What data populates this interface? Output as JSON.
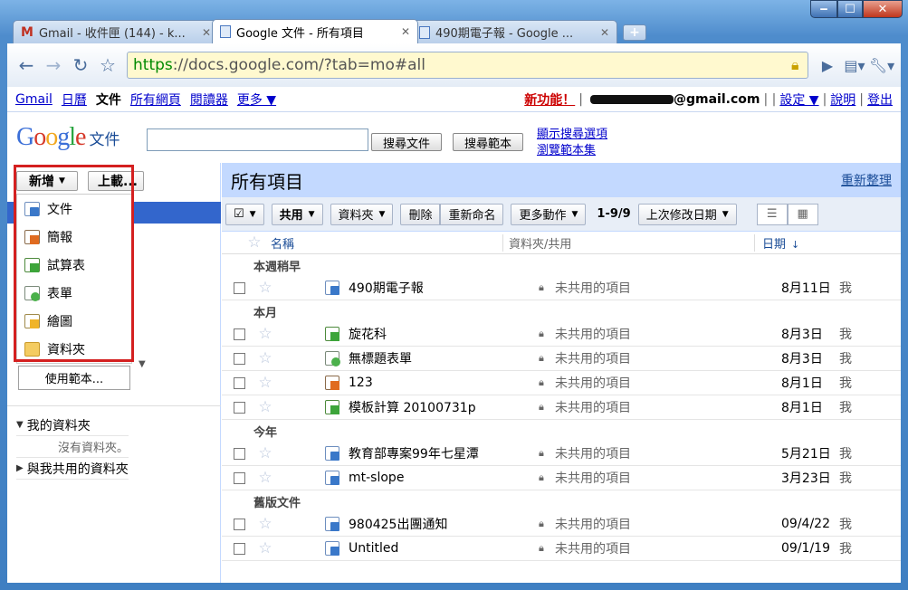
{
  "browser": {
    "tabs": [
      {
        "title": "Gmail - 收件匣 (144) - k...",
        "icon": "gmail-icon"
      },
      {
        "title": "Google 文件 - 所有項目",
        "icon": "docs-icon",
        "active": true
      },
      {
        "title": "490期電子報 - Google ...",
        "icon": "docs-icon"
      }
    ],
    "url_scheme": "https",
    "url_rest": "://docs.google.com/?tab=mo#all"
  },
  "gbar": {
    "links": [
      "Gmail",
      "日曆",
      "文件",
      "所有網頁",
      "閱讀器",
      "更多 ▼"
    ],
    "new_feature": "新功能！",
    "email_suffix": "@gmail.com",
    "settings": "設定 ▼",
    "help": "說明",
    "signout": "登出"
  },
  "header": {
    "logo": "Google",
    "product": "文件",
    "search_docs": "搜尋文件",
    "search_templates": "搜尋範本",
    "show_options": "顯示搜尋選項",
    "browse_templates": "瀏覽範本集"
  },
  "left": {
    "new_button": "新增",
    "upload_button": "上載...",
    "menu": [
      {
        "label": "文件",
        "icon": "document-icon"
      },
      {
        "label": "簡報",
        "icon": "presentation-icon"
      },
      {
        "label": "試算表",
        "icon": "spreadsheet-icon"
      },
      {
        "label": "表單",
        "icon": "form-icon"
      },
      {
        "label": "繪圖",
        "icon": "drawing-icon"
      },
      {
        "label": "資料夾",
        "icon": "folder-icon"
      }
    ],
    "template_button": "使用範本...",
    "my_folders": "我的資料夾",
    "no_folders": "沒有資料夾。",
    "shared_folders": "與我共用的資料夾"
  },
  "main": {
    "title": "所有項目",
    "refresh": "重新整理",
    "actions": {
      "share": "共用",
      "folders": "資料夾",
      "delete": "刪除",
      "rename": "重新命名",
      "more": "更多動作",
      "count": "1-9/9",
      "sort": "上次修改日期"
    },
    "columns": {
      "name": "名稱",
      "folder": "資料夾/共用",
      "date": "日期"
    },
    "groups": [
      {
        "label": "本週稍早",
        "rows": [
          {
            "name": "490期電子報",
            "type": "doc",
            "share": "未共用的項目",
            "date": "8月11日",
            "owner": "我"
          }
        ]
      },
      {
        "label": "本月",
        "rows": [
          {
            "name": "旋花科",
            "type": "sheet",
            "share": "未共用的項目",
            "date": "8月3日",
            "owner": "我"
          },
          {
            "name": "無標題表單",
            "type": "form",
            "share": "未共用的項目",
            "date": "8月3日",
            "owner": "我"
          },
          {
            "name": "123",
            "type": "pres",
            "share": "未共用的項目",
            "date": "8月1日",
            "owner": "我"
          },
          {
            "name": "模板計算 20100731p",
            "type": "sheet",
            "share": "未共用的項目",
            "date": "8月1日",
            "owner": "我"
          }
        ]
      },
      {
        "label": "今年",
        "rows": [
          {
            "name": "教育部專案99年七星潭",
            "type": "doc",
            "share": "未共用的項目",
            "date": "5月21日",
            "owner": "我"
          },
          {
            "name": "mt-slope",
            "type": "doc",
            "share": "未共用的項目",
            "date": "3月23日",
            "owner": "我"
          }
        ]
      },
      {
        "label": "舊版文件",
        "rows": [
          {
            "name": "980425出團通知",
            "type": "doc",
            "share": "未共用的項目",
            "date": "09/4/22",
            "owner": "我"
          },
          {
            "name": "Untitled",
            "type": "doc",
            "share": "未共用的項目",
            "date": "09/1/19",
            "owner": "我"
          }
        ]
      }
    ]
  },
  "colors": {
    "accent": "#3366cc",
    "header_bg": "#c3d9ff",
    "highlight": "#d42020"
  }
}
